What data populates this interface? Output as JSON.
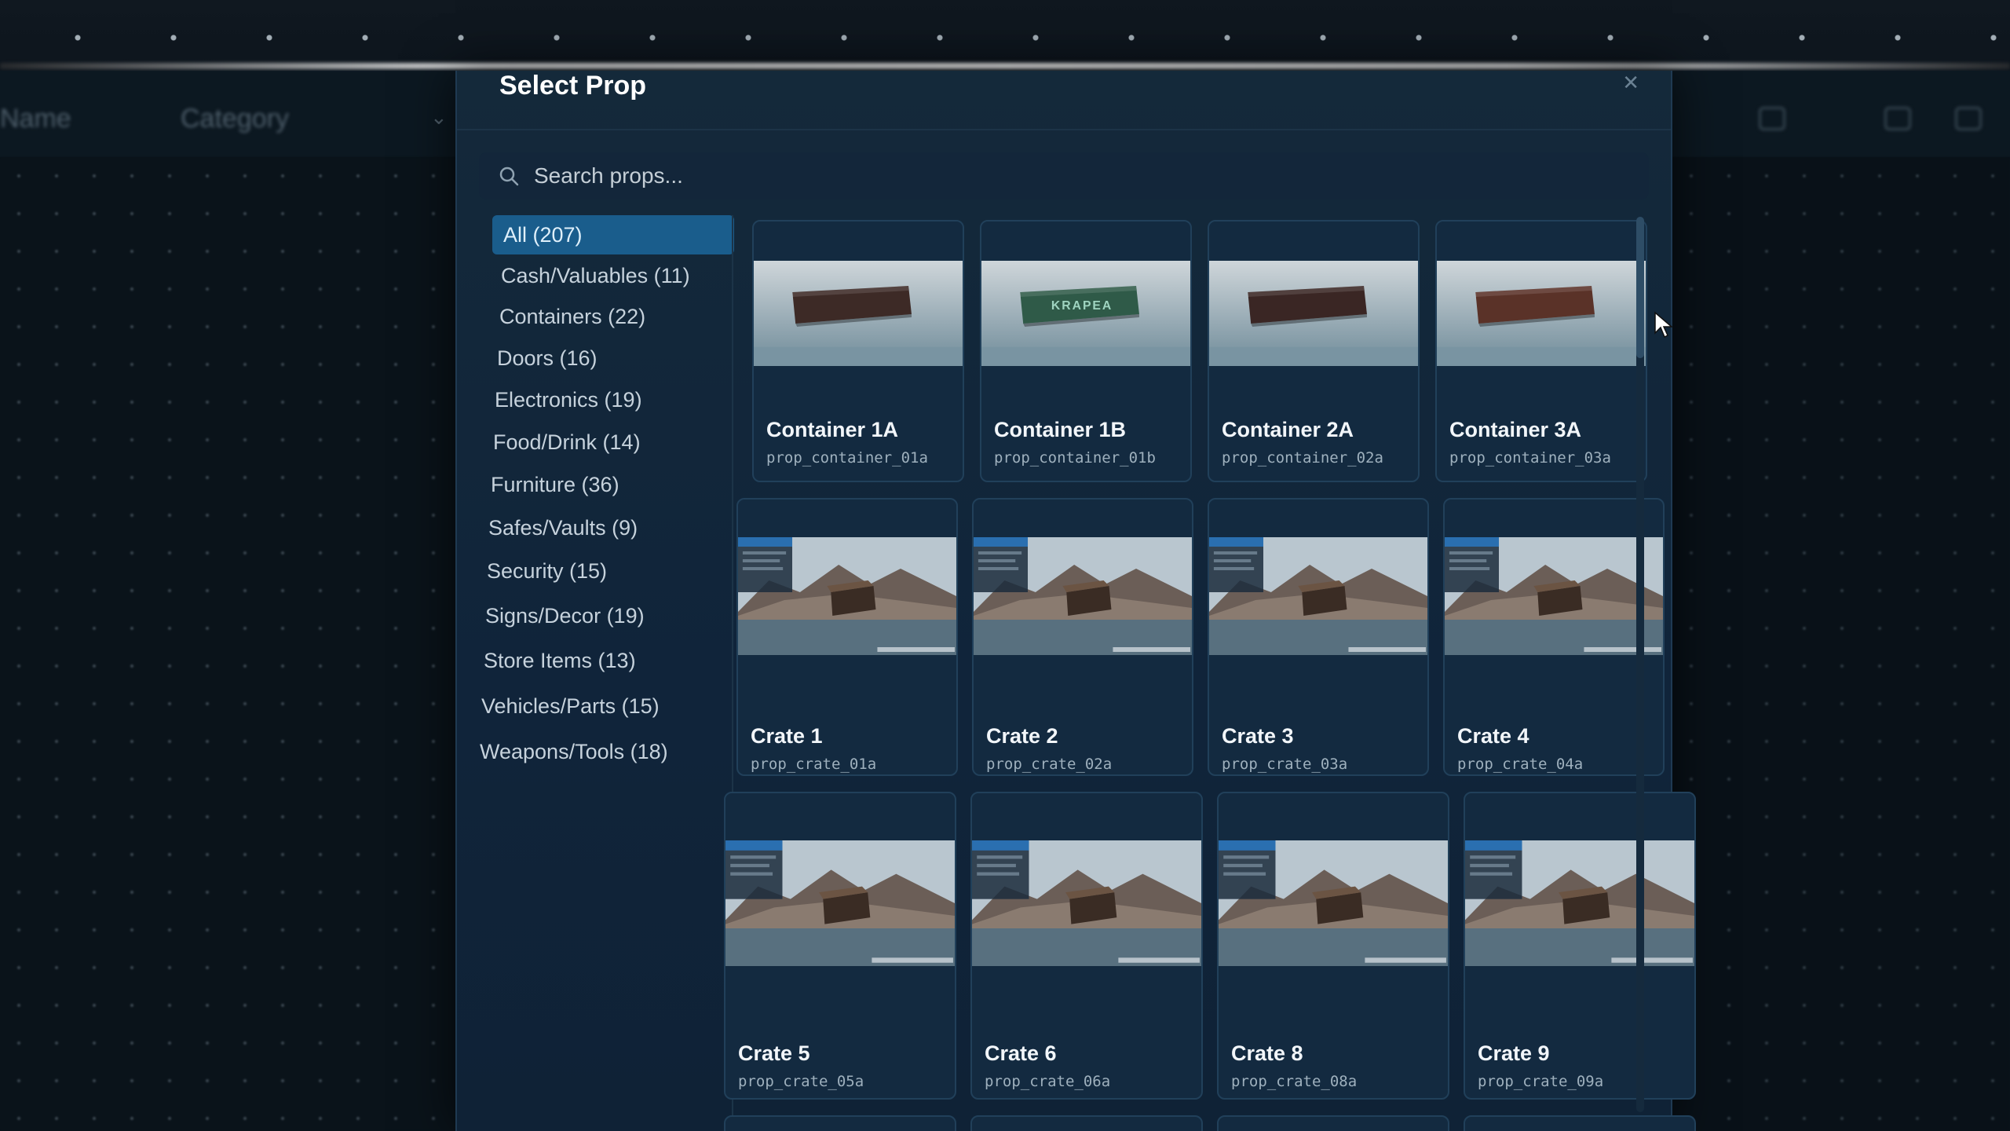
{
  "background": {
    "name_label": "Name",
    "category_label": "Category"
  },
  "modal": {
    "title": "Select Prop",
    "close_icon": "close-icon"
  },
  "search": {
    "placeholder": "Search props...",
    "value": ""
  },
  "categories": [
    {
      "label": "All (207)",
      "active": true
    },
    {
      "label": "Cash/Valuables (11)",
      "active": false
    },
    {
      "label": "Containers (22)",
      "active": false
    },
    {
      "label": "Doors (16)",
      "active": false
    },
    {
      "label": "Electronics (19)",
      "active": false
    },
    {
      "label": "Food/Drink (14)",
      "active": false
    },
    {
      "label": "Furniture (36)",
      "active": false
    },
    {
      "label": "Safes/Vaults (9)",
      "active": false
    },
    {
      "label": "Security (15)",
      "active": false
    },
    {
      "label": "Signs/Decor (19)",
      "active": false
    },
    {
      "label": "Store Items (13)",
      "active": false
    },
    {
      "label": "Vehicles/Parts (15)",
      "active": false
    },
    {
      "label": "Weapons/Tools (18)",
      "active": false
    }
  ],
  "props": [
    {
      "name": "Container 1A",
      "model": "prop_container_01a",
      "thumb": "container",
      "color": "#3d2a26"
    },
    {
      "name": "Container 1B",
      "model": "prop_container_01b",
      "thumb": "container",
      "color": "#2f5a48",
      "label": "KRAPEA"
    },
    {
      "name": "Container 2A",
      "model": "prop_container_02a",
      "thumb": "container",
      "color": "#3a2624"
    },
    {
      "name": "Container 3A",
      "model": "prop_container_03a",
      "thumb": "container",
      "color": "#5a3228"
    },
    {
      "name": "Crate 1",
      "model": "prop_crate_01a",
      "thumb": "crate"
    },
    {
      "name": "Crate 2",
      "model": "prop_crate_02a",
      "thumb": "crate"
    },
    {
      "name": "Crate 3",
      "model": "prop_crate_03a",
      "thumb": "crate"
    },
    {
      "name": "Crate 4",
      "model": "prop_crate_04a",
      "thumb": "crate"
    },
    {
      "name": "Crate 5",
      "model": "prop_crate_05a",
      "thumb": "crate"
    },
    {
      "name": "Crate 6",
      "model": "prop_crate_06a",
      "thumb": "crate"
    },
    {
      "name": "Crate 8",
      "model": "prop_crate_08a",
      "thumb": "crate"
    },
    {
      "name": "Crate 9",
      "model": "prop_crate_09a",
      "thumb": "crate"
    }
  ]
}
